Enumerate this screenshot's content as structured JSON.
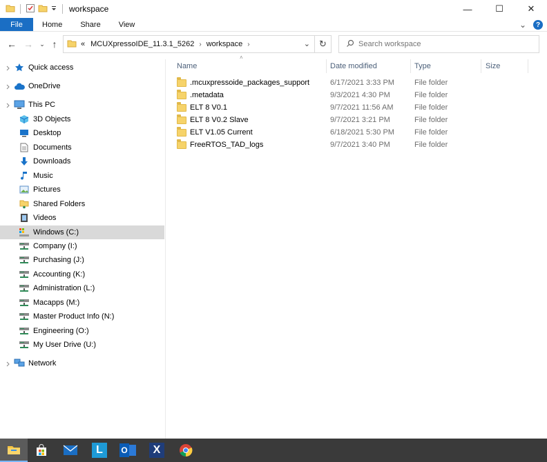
{
  "window": {
    "title": "workspace",
    "controls": {
      "minimize": "—",
      "maximize": "☐",
      "close": "✕"
    }
  },
  "ribbon": {
    "tabs": [
      "File",
      "Home",
      "Share",
      "View"
    ],
    "expand": "⌄",
    "help": "?"
  },
  "address": {
    "overflow": "«",
    "crumbs": [
      "MCUXpressoIDE_11.3.1_5262",
      "workspace"
    ],
    "separator": "›",
    "dropdown": "⌄",
    "refresh": "↻"
  },
  "nav_buttons": {
    "back": "←",
    "forward": "→",
    "recent": "⌄",
    "up": "↑"
  },
  "search": {
    "placeholder": "Search workspace"
  },
  "nav_pane": {
    "selected": "Windows (C:)",
    "items": [
      {
        "label": "Quick access",
        "icon": "star-icon",
        "indent": 0
      },
      {
        "label": "OneDrive",
        "icon": "cloud-icon",
        "indent": 0
      },
      {
        "label": "This PC",
        "icon": "computer-icon",
        "indent": 0
      },
      {
        "label": "3D Objects",
        "icon": "cube-icon",
        "indent": 1
      },
      {
        "label": "Desktop",
        "icon": "desktop-icon",
        "indent": 1
      },
      {
        "label": "Documents",
        "icon": "document-icon",
        "indent": 1
      },
      {
        "label": "Downloads",
        "icon": "download-icon",
        "indent": 1
      },
      {
        "label": "Music",
        "icon": "music-icon",
        "indent": 1
      },
      {
        "label": "Pictures",
        "icon": "picture-icon",
        "indent": 1
      },
      {
        "label": "Shared Folders",
        "icon": "shared-folder-icon",
        "indent": 1
      },
      {
        "label": "Videos",
        "icon": "video-icon",
        "indent": 1
      },
      {
        "label": "Windows (C:)",
        "icon": "drive-icon",
        "indent": 1
      },
      {
        "label": "Company (I:)",
        "icon": "network-drive-icon",
        "indent": 1
      },
      {
        "label": "Purchasing (J:)",
        "icon": "network-drive-icon",
        "indent": 1
      },
      {
        "label": "Accounting (K:)",
        "icon": "network-drive-icon",
        "indent": 1
      },
      {
        "label": "Administration (L:)",
        "icon": "network-drive-icon",
        "indent": 1
      },
      {
        "label": "Macapps (M:)",
        "icon": "network-drive-icon",
        "indent": 1
      },
      {
        "label": "Master Product Info (N:)",
        "icon": "network-drive-icon",
        "indent": 1
      },
      {
        "label": "Engineering (O:)",
        "icon": "network-drive-icon",
        "indent": 1
      },
      {
        "label": "My User Drive (U:)",
        "icon": "network-drive-icon",
        "indent": 1
      },
      {
        "label": "Network",
        "icon": "network-icon",
        "indent": 0
      }
    ]
  },
  "file_list": {
    "columns": [
      "Name",
      "Date modified",
      "Type",
      "Size"
    ],
    "sort_indicator": "˄",
    "rows": [
      {
        "name": ".mcuxpressoide_packages_support",
        "date": "6/17/2021 3:33 PM",
        "type": "File folder"
      },
      {
        "name": ".metadata",
        "date": "9/3/2021 4:30 PM",
        "type": "File folder"
      },
      {
        "name": "ELT 8 V0.1",
        "date": "9/7/2021 11:56 AM",
        "type": "File folder"
      },
      {
        "name": "ELT 8 V0.2 Slave",
        "date": "9/7/2021 3:21 PM",
        "type": "File folder"
      },
      {
        "name": "ELT V1.05 Current",
        "date": "6/18/2021 5:30 PM",
        "type": "File folder"
      },
      {
        "name": "FreeRTOS_TAD_logs",
        "date": "9/7/2021 3:40 PM",
        "type": "File folder"
      }
    ]
  },
  "taskbar": {
    "apps": [
      "file-explorer-icon",
      "store-icon",
      "mail-icon",
      "l-app-icon",
      "outlook-icon",
      "x-app-icon",
      "chrome-icon"
    ],
    "l_letter": "L",
    "o_letter": "O",
    "x_letter": "X"
  },
  "colors": {
    "accent": "#1a6ec4",
    "folder": "#f6d36a",
    "selected_bg": "#d9d9d9",
    "taskbar": "#3a3a3a"
  }
}
